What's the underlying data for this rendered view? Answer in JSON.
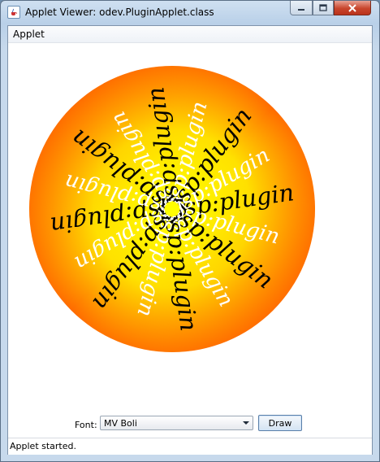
{
  "window": {
    "title": "Applet Viewer: odev.PluginApplet.class",
    "icons": {
      "app": "java-cup-icon",
      "minimize": "minimize-icon",
      "maximize": "maximize-icon",
      "close": "close-icon"
    }
  },
  "menubar": {
    "applet_label": "Applet"
  },
  "canvas": {
    "spiral_text": "jsp:plugin",
    "colors": {
      "gradient_inner": "#ffff00",
      "gradient_outer": "#ff5a00",
      "text_dark": "#000000",
      "text_light": "#ffffff"
    }
  },
  "controls": {
    "font_label": "Font:",
    "font_value": "MV Boli",
    "draw_label": "Draw"
  },
  "status": {
    "text": "Applet started."
  }
}
